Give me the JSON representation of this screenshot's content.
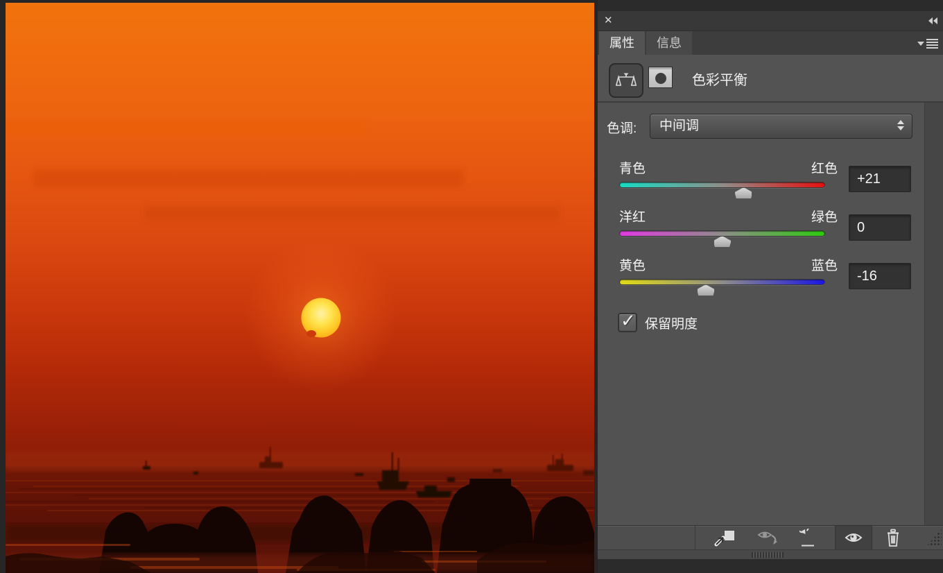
{
  "window": {
    "close_glyph": "✕"
  },
  "panel": {
    "tabs": [
      {
        "label": "属性"
      },
      {
        "label": "信息"
      }
    ],
    "header": {
      "title": "色彩平衡",
      "adjustment_icon": "color-balance-scales-icon",
      "mask_icon": "layer-mask-thumbnail"
    },
    "tone": {
      "label": "色调:",
      "value": "中间调"
    },
    "sliders": [
      {
        "left_label": "青色",
        "right_label": "红色",
        "value": "+21",
        "number": 21,
        "gradient": [
          "#17dcc4",
          "#8f8d89",
          "#e61111"
        ]
      },
      {
        "left_label": "洋红",
        "right_label": "绿色",
        "value": "0",
        "number": 0,
        "gradient": [
          "#e23ae2",
          "#8f8d89",
          "#2fcb11"
        ]
      },
      {
        "left_label": "黄色",
        "right_label": "蓝色",
        "value": "-16",
        "number": -16,
        "gradient": [
          "#dfdb15",
          "#8f8d89",
          "#1b16e2"
        ]
      }
    ],
    "checkbox": {
      "label": "保留明度",
      "checked": true,
      "check_glyph": "✓"
    },
    "toolbar_icons": [
      "clip-to-layer-icon",
      "view-previous-state-icon",
      "reset-icon",
      "layer-visibility-icon",
      "delete-adjustment-icon"
    ]
  },
  "photo": {
    "description": "红色日落海景：橙红天空、落日、远处渔船与礁石剪影",
    "palette": {
      "sky_top": "#f1730d",
      "sky_horizon": "#8a1c07",
      "sea": "#5a1106",
      "sun": "#ffe34f",
      "silhouette": "#140402"
    }
  }
}
